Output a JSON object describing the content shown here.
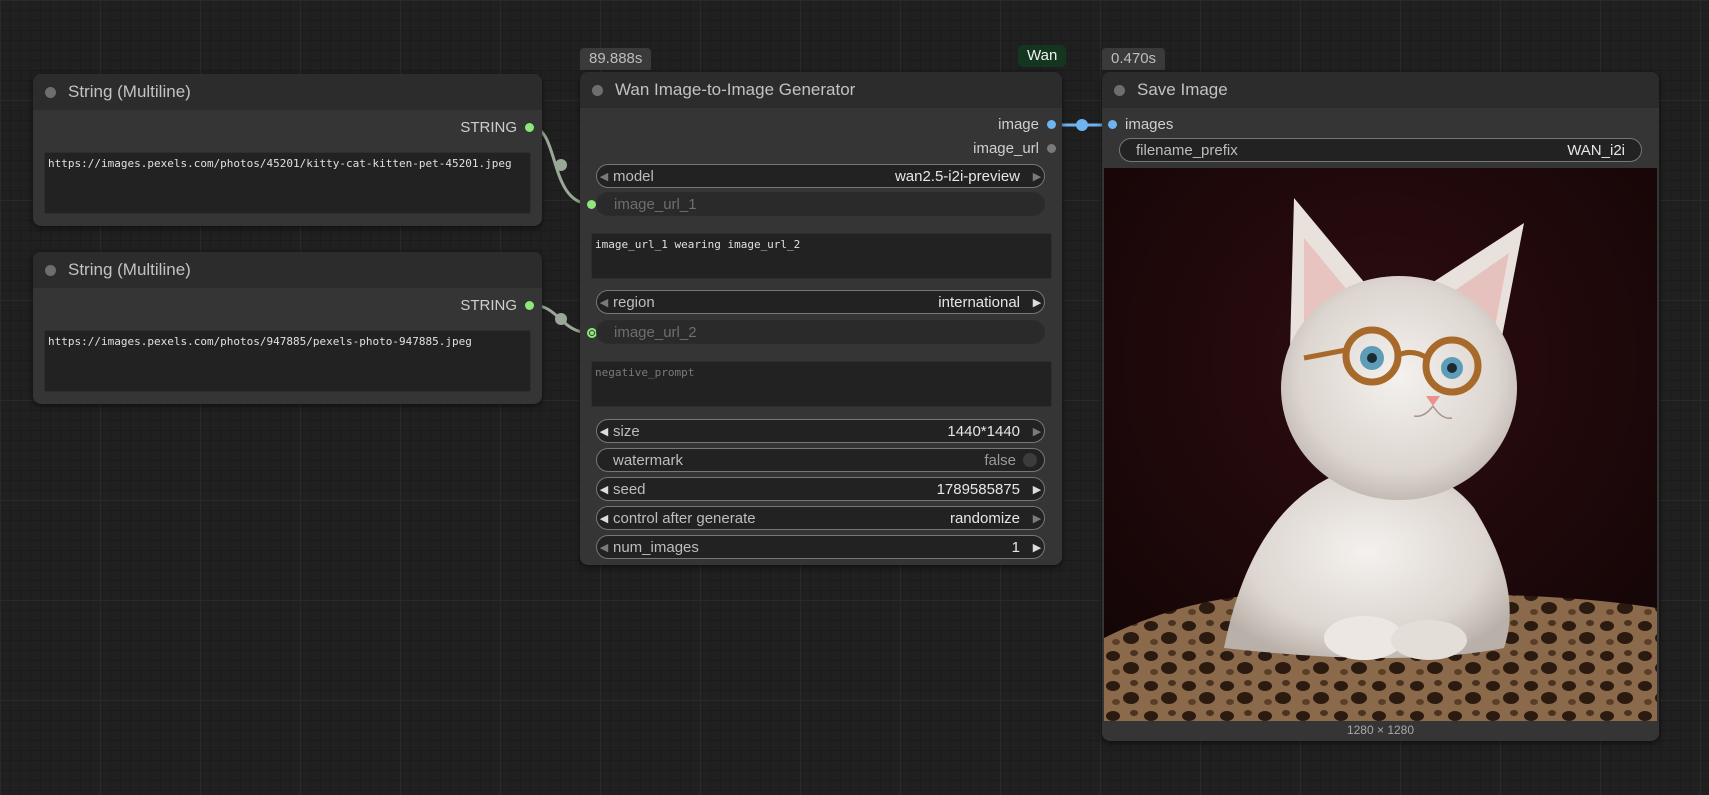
{
  "nodes": {
    "string1": {
      "title": "String (Multiline)",
      "output_label": "STRING",
      "text": "https://images.pexels.com/photos/45201/kitty-cat-kitten-pet-45201.jpeg"
    },
    "string2": {
      "title": "String (Multiline)",
      "output_label": "STRING",
      "text": "https://images.pexels.com/photos/947885/pexels-photo-947885.jpeg"
    },
    "wan": {
      "title": "Wan Image-to-Image Generator",
      "time_badge": "89.888s",
      "group_badge": "Wan",
      "outputs": [
        "image",
        "image_url"
      ],
      "model": {
        "label": "model",
        "value": "wan2.5-i2i-preview"
      },
      "image_url_1": "image_url_1",
      "prompt": "image_url_1 wearing image_url_2",
      "region": {
        "label": "region",
        "value": "international"
      },
      "image_url_2": "image_url_2",
      "negative_prompt_placeholder": "negative_prompt",
      "size": {
        "label": "size",
        "value": "1440*1440"
      },
      "watermark": {
        "label": "watermark",
        "value": "false"
      },
      "seed": {
        "label": "seed",
        "value": "1789585875"
      },
      "control_after_generate": {
        "label": "control after generate",
        "value": "randomize"
      },
      "num_images": {
        "label": "num_images",
        "value": "1"
      }
    },
    "save": {
      "title": "Save Image",
      "time_badge": "0.470s",
      "input_label": "images",
      "filename_prefix": {
        "label": "filename_prefix",
        "value": "WAN_i2i"
      },
      "image_dimensions": "1280 × 1280"
    }
  },
  "colors": {
    "string_socket": "#8de87a",
    "image_socket": "#6eb4f0",
    "link_string": "#9aa898",
    "link_image": "#6eb4f0"
  }
}
